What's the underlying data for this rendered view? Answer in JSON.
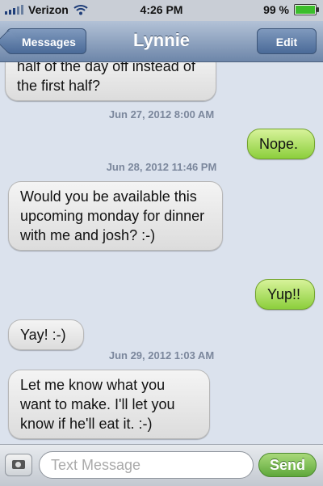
{
  "status_bar": {
    "carrier": "Verizon",
    "time": "4:26 PM",
    "battery": "99 %",
    "battery_level": 0.99,
    "wifi_icon": "wifi-icon"
  },
  "nav": {
    "back_label": "Messages",
    "title": "Lynnie",
    "edit_label": "Edit"
  },
  "messages": [
    {
      "type": "in",
      "text": "half of the day off instead of the first half?"
    },
    {
      "type": "stamp",
      "text": "Jun 27, 2012 8:00 AM"
    },
    {
      "type": "out",
      "text": "Nope."
    },
    {
      "type": "stamp",
      "text": "Jun 28, 2012 11:46 PM"
    },
    {
      "type": "in",
      "text": "Would you be available this upcoming monday for dinner with me and josh? :-)"
    },
    {
      "type": "out",
      "text": "Yup!!"
    },
    {
      "type": "in",
      "text": "Yay! :-)"
    },
    {
      "type": "stamp",
      "text": "Jun 29, 2012 1:03 AM"
    },
    {
      "type": "in",
      "text": "Let me know what you want to make. I'll let you know if he'll eat it. :-)"
    }
  ],
  "input_bar": {
    "camera_icon": "camera-icon",
    "placeholder": "Text Message",
    "send_label": "Send"
  },
  "colors": {
    "incoming_bubble": "#e6e6e6",
    "outgoing_bubble": "#a9dd5a",
    "nav_bar": "#6d86a9",
    "background": "#dbe2ed"
  }
}
